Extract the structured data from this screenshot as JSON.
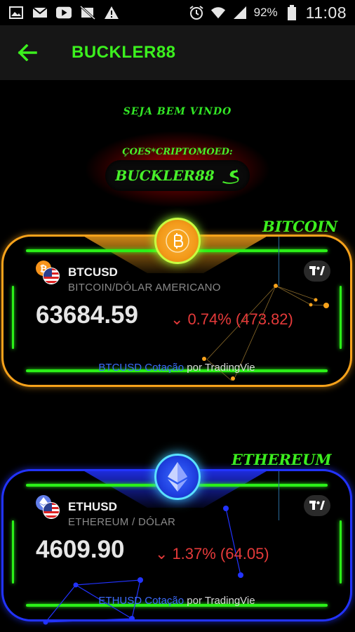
{
  "status_bar": {
    "battery_percent": "92%",
    "time": "11:08",
    "left_icons": [
      "image-icon",
      "mail-icon",
      "youtube-icon",
      "no-image-icon",
      "warning-icon"
    ],
    "right_icons": [
      "alarm-icon",
      "wifi-icon",
      "signal-icon",
      "battery-icon"
    ]
  },
  "app_bar": {
    "title": "BUCKLER88",
    "back_icon": "arrow-left-icon"
  },
  "welcome": "SEJA BEM VINDO",
  "promo": {
    "ticker": "ÇOES*CRIPTOMOED:",
    "name": "BUCKLER88"
  },
  "colors": {
    "accent_green": "#2bef18",
    "btc_orange": "#f7a21b",
    "eth_blue": "#2233ff",
    "down_red": "#e53a3a",
    "link_blue": "#3d6cff"
  },
  "cards": [
    {
      "label": "BITCOIN",
      "symbol": "BTCUSD",
      "description": "BITCOIN/DÓLAR AMERICANO",
      "price": "63684.59",
      "change_arrow": "⌄",
      "change": "0.74% (473.82)",
      "attribution_link": "BTCUSD Cotação",
      "attribution_rest": " por TradingVie",
      "coin_icon": "bitcoin-icon"
    },
    {
      "label": "ETHEREUM",
      "symbol": "ETHUSD",
      "description": "ETHEREUM / DÓLAR",
      "price": "4609.90",
      "change_arrow": "⌄",
      "change": "1.37% (64.05)",
      "attribution_link": "ETHUSD Cotação",
      "attribution_rest": " por TradingVie",
      "coin_icon": "ethereum-icon"
    }
  ]
}
